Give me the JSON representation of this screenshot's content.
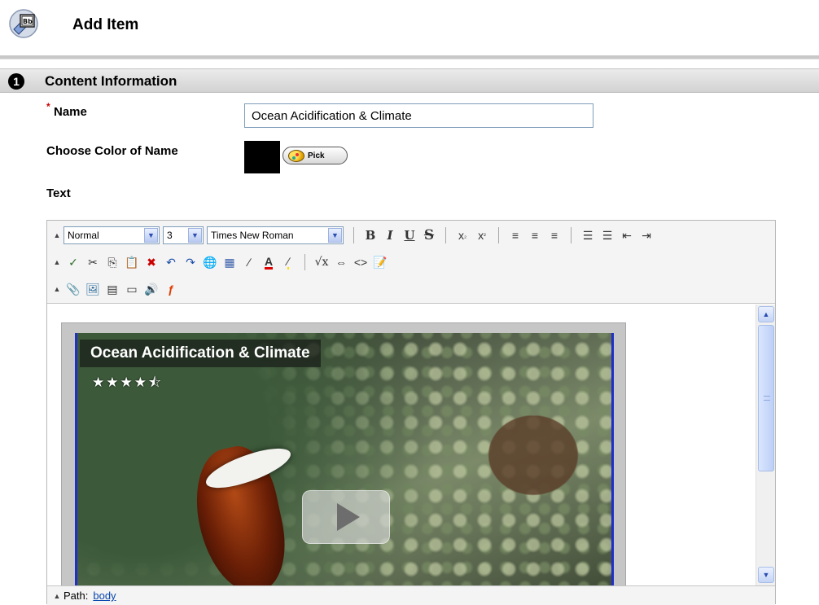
{
  "page": {
    "title": "Add Item"
  },
  "section": {
    "step": "1",
    "title": "Content Information"
  },
  "form": {
    "required_marker": "*",
    "name_label": "Name",
    "name_value": "Ocean Acidification & Climate",
    "color_label": "Choose Color of Name",
    "color_value": "#000000",
    "pick_label": "Pick",
    "text_label": "Text"
  },
  "editor": {
    "toolbar": {
      "format_select": "Normal",
      "size_select": "3",
      "font_select": "Times New Roman",
      "bold": "B",
      "italic": "I",
      "underline": "U",
      "strike": "S"
    },
    "content": {
      "video_title": "Ocean Acidification & Climate",
      "video_rating": 4.5,
      "video_rating_stars": "★★★★★"
    },
    "status": {
      "path_label": "Path:",
      "path_value": "body"
    }
  },
  "colors": {
    "section_bar": "#d8d8d8",
    "required_star": "#cc0000",
    "link": "#0645ad",
    "player_border": "#1f2fc8"
  }
}
